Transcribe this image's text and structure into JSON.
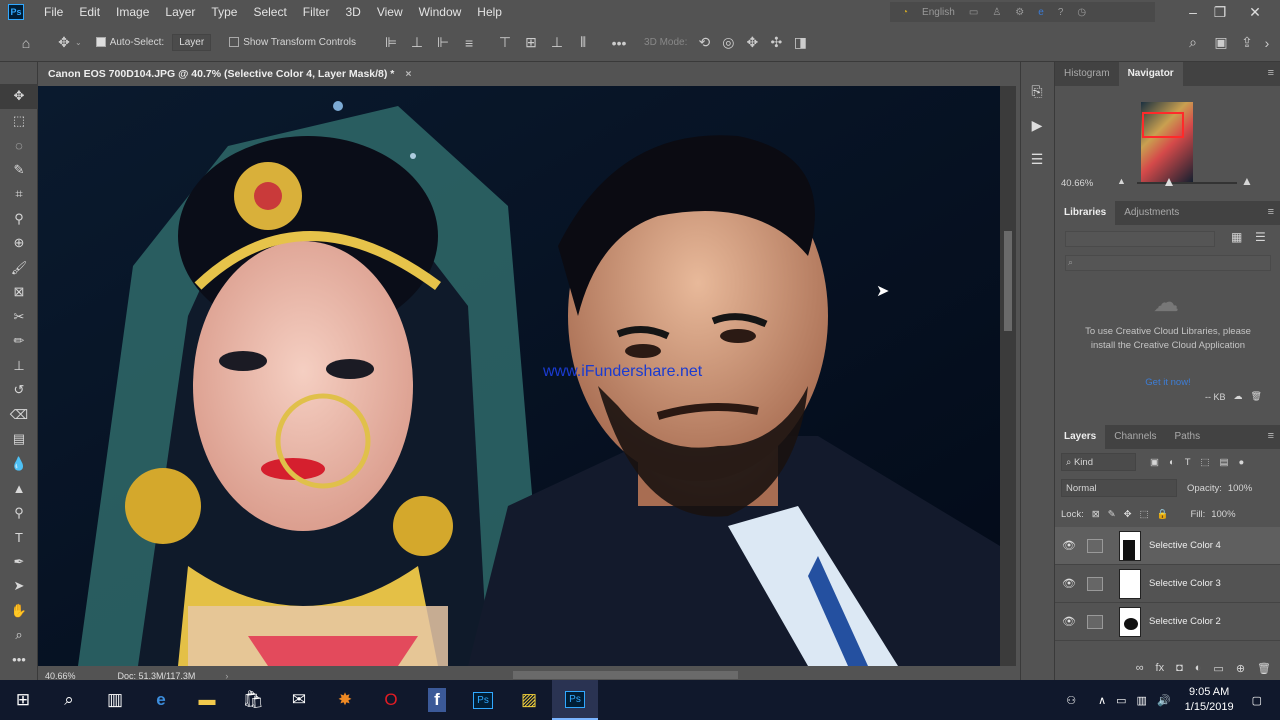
{
  "app": {
    "logo": "Ps"
  },
  "menu": [
    "File",
    "Edit",
    "Image",
    "Layer",
    "Type",
    "Select",
    "Filter",
    "3D",
    "View",
    "Window",
    "Help"
  ],
  "search_region": {
    "language": "English"
  },
  "options": {
    "auto_select_label": "Auto-Select:",
    "auto_select_target": "Layer",
    "transform_label": "Show Transform Controls",
    "mode_label": "3D Mode:"
  },
  "document": {
    "tab_title": "Canon EOS 700D104.JPG @ 40.7% (Selective Color 4, Layer Mask/8) *",
    "close_glyph": "×",
    "watermark": "www.iFundershare.net",
    "zoom_status": "40.66%",
    "doc_size": "Doc: 51.3M/117.3M"
  },
  "navigator": {
    "tabs": [
      "Histogram",
      "Navigator"
    ],
    "active_tab": "Navigator",
    "zoom": "40.66%",
    "zoom_level": 0.32
  },
  "libraries": {
    "tabs": [
      "Libraries",
      "Adjustments"
    ],
    "message": "To use Creative Cloud Libraries, please install the Creative Cloud Application",
    "link": "Get it now!",
    "size": "-- KB"
  },
  "layers": {
    "tabs": [
      "Layers",
      "Channels",
      "Paths"
    ],
    "filter_kind": "Kind",
    "blend_mode": "Normal",
    "opacity_label": "Opacity:",
    "opacity": "100%",
    "lock_label": "Lock:",
    "fill_label": "Fill:",
    "fill": "100%",
    "items": [
      {
        "name": "Selective Color 4",
        "selected": true
      },
      {
        "name": "Selective Color 3",
        "selected": false
      },
      {
        "name": "Selective Color 2",
        "selected": false
      }
    ]
  },
  "taskbar": {
    "clock_time": "9:05 AM",
    "clock_date": "1/15/2019",
    "accent": "#2a3352"
  }
}
